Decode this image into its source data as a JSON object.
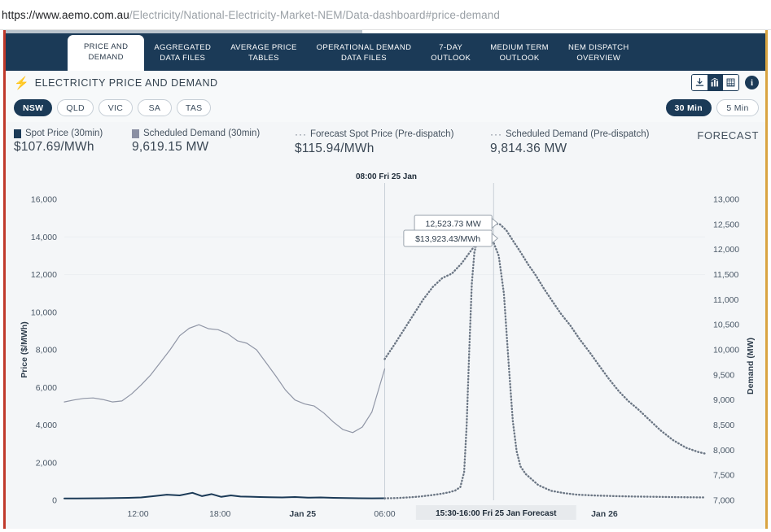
{
  "browser": {
    "url_host": "https://www.aemo.com.au",
    "url_path": "/Electricity/National-Electricity-Market-NEM/Data-dashboard#price-demand"
  },
  "tabs": [
    {
      "label": "PRICE AND\nDEMAND",
      "active": true
    },
    {
      "label": "AGGREGATED\nDATA FILES",
      "active": false
    },
    {
      "label": "AVERAGE PRICE\nTABLES",
      "active": false
    },
    {
      "label": "OPERATIONAL DEMAND\nDATA FILES",
      "active": false
    },
    {
      "label": "7-DAY\nOUTLOOK",
      "active": false
    },
    {
      "label": "MEDIUM TERM\nOUTLOOK",
      "active": false
    },
    {
      "label": "NEM DISPATCH\nOVERVIEW",
      "active": false
    }
  ],
  "header": {
    "title": "ELECTRICITY PRICE AND DEMAND",
    "bolt_icon": "lightning-bolt-icon",
    "icons": [
      {
        "name": "download-icon",
        "glyph": "⤓",
        "active": false
      },
      {
        "name": "chart-icon",
        "glyph": "█",
        "active": true
      },
      {
        "name": "table-icon",
        "glyph": "▦",
        "active": false
      }
    ],
    "info_label": "i"
  },
  "regions": [
    {
      "label": "NSW",
      "selected": true
    },
    {
      "label": "QLD",
      "selected": false
    },
    {
      "label": "VIC",
      "selected": false
    },
    {
      "label": "SA",
      "selected": false
    },
    {
      "label": "TAS",
      "selected": false
    }
  ],
  "intervals": [
    {
      "label": "30 Min",
      "selected": true
    },
    {
      "label": "5 Min",
      "selected": false
    }
  ],
  "legend": [
    {
      "name": "Spot Price (30min)",
      "value": "$107.69/MWh",
      "color": "#1b3a57",
      "style": "solid"
    },
    {
      "name": "Scheduled Demand (30min)",
      "value": "9,619.15 MW",
      "color": "#8a8fa3",
      "style": "solid"
    },
    {
      "name": "Forecast Spot Price (Pre-dispatch)",
      "value": "$115.94/MWh",
      "color": "#6b7684",
      "style": "dotted"
    },
    {
      "name": "Scheduled Demand (Pre-dispatch)",
      "value": "9,814.36 MW",
      "color": "#6b7684",
      "style": "dotted"
    }
  ],
  "forecast_label": "FORECAST",
  "chart_data": {
    "type": "line",
    "title": "ELECTRICITY PRICE AND DEMAND",
    "xlabel": "",
    "ylabel": "Price ($/MWh)",
    "y2label": "Demand (MW)",
    "ylim": [
      0,
      16000
    ],
    "y2lim": [
      7000,
      13000
    ],
    "yticks": [
      0,
      2000,
      4000,
      6000,
      8000,
      10000,
      12000,
      14000,
      16000
    ],
    "yticklabels": [
      "0",
      "2,000",
      "4,000",
      "6,000",
      "8,000",
      "10,000",
      "12,000",
      "14,000",
      "16,000"
    ],
    "y2ticks": [
      7000,
      7500,
      8000,
      8500,
      9000,
      9500,
      10000,
      10500,
      11000,
      11500,
      12000,
      12500,
      13000
    ],
    "y2ticklabels": [
      "7,000",
      "7,500",
      "8,000",
      "8,500",
      "9,000",
      "9,500",
      "10,000",
      "10,500",
      "11,000",
      "11,500",
      "12,000",
      "12,500",
      "13,000"
    ],
    "grid": false,
    "legend_position": "top",
    "xticks": [
      {
        "pos": 0.115,
        "label": "12:00",
        "bold": false
      },
      {
        "pos": 0.243,
        "label": "18:00",
        "bold": false
      },
      {
        "pos": 0.372,
        "label": "Jan 25",
        "bold": true
      },
      {
        "pos": 0.5,
        "label": "06:00",
        "bold": false
      },
      {
        "pos": 0.843,
        "label": "Jan 26",
        "bold": true
      }
    ],
    "now_marker": {
      "pos": 0.5,
      "label": "08:00 Fri 25 Jan"
    },
    "cursor_marker": {
      "pos": 0.67,
      "label": "15:30-16:00 Fri 25 Jan Forecast"
    },
    "tooltips": [
      {
        "text": "12,523.73 MW",
        "pos": 0.67,
        "value": 12523.73,
        "axis": "right"
      },
      {
        "text": "$13,923.43/MWh",
        "pos": 0.67,
        "value": 13923.43,
        "axis": "left"
      }
    ],
    "series": [
      {
        "name": "Spot Price (30min)",
        "axis": "left",
        "style": "solid",
        "color": "#1b3a57",
        "width": 2,
        "x": [
          0.0,
          0.02,
          0.04,
          0.06,
          0.08,
          0.1,
          0.12,
          0.14,
          0.16,
          0.18,
          0.2,
          0.215,
          0.23,
          0.245,
          0.26,
          0.275,
          0.29,
          0.305,
          0.32,
          0.34,
          0.36,
          0.38,
          0.4,
          0.42,
          0.44,
          0.46,
          0.48,
          0.5
        ],
        "y": [
          95,
          100,
          105,
          110,
          115,
          130,
          150,
          220,
          300,
          260,
          400,
          220,
          330,
          180,
          260,
          200,
          190,
          175,
          160,
          150,
          175,
          140,
          150,
          130,
          120,
          110,
          105,
          107.69
        ]
      },
      {
        "name": "Scheduled Demand (30min)",
        "axis": "right",
        "style": "solid",
        "color": "#9096a6",
        "width": 1.2,
        "x": [
          0.0,
          0.015,
          0.03,
          0.045,
          0.06,
          0.075,
          0.09,
          0.105,
          0.12,
          0.135,
          0.15,
          0.165,
          0.18,
          0.195,
          0.21,
          0.225,
          0.24,
          0.255,
          0.27,
          0.285,
          0.3,
          0.315,
          0.33,
          0.345,
          0.36,
          0.375,
          0.39,
          0.405,
          0.42,
          0.435,
          0.45,
          0.465,
          0.48,
          0.5
        ],
        "y": [
          8960,
          9000,
          9030,
          9040,
          9010,
          8960,
          8980,
          9120,
          9300,
          9500,
          9750,
          10000,
          10280,
          10430,
          10500,
          10420,
          10400,
          10320,
          10180,
          10130,
          10000,
          9740,
          9480,
          9200,
          9000,
          8920,
          8880,
          8740,
          8560,
          8410,
          8350,
          8460,
          8760,
          9619.15
        ]
      },
      {
        "name": "Forecast Spot Price (Pre-dispatch)",
        "axis": "left",
        "style": "dotted",
        "color": "#6b7684",
        "width": 2.4,
        "x": [
          0.5,
          0.52,
          0.54,
          0.555,
          0.57,
          0.585,
          0.6,
          0.61,
          0.618,
          0.624,
          0.628,
          0.632,
          0.636,
          0.64,
          0.644,
          0.648,
          0.652,
          0.656,
          0.66,
          0.665,
          0.67,
          0.678,
          0.686,
          0.694,
          0.7,
          0.706,
          0.712,
          0.72,
          0.74,
          0.76,
          0.78,
          0.8,
          0.83,
          0.86,
          0.89,
          0.92,
          0.95,
          0.975,
          1.0
        ],
        "y": [
          105,
          120,
          160,
          200,
          260,
          330,
          420,
          520,
          700,
          1500,
          4000,
          8000,
          11500,
          13200,
          13700,
          13900,
          13923.43,
          13900,
          13850,
          13800,
          13700,
          13000,
          11000,
          7000,
          4200,
          2600,
          1800,
          1400,
          800,
          500,
          380,
          300,
          250,
          220,
          200,
          185,
          170,
          160,
          150
        ]
      },
      {
        "name": "Scheduled Demand (Pre-dispatch)",
        "axis": "right",
        "style": "dotted",
        "color": "#6b7684",
        "width": 2.4,
        "x": [
          0.5,
          0.515,
          0.53,
          0.545,
          0.56,
          0.575,
          0.59,
          0.605,
          0.62,
          0.635,
          0.65,
          0.66,
          0.67,
          0.68,
          0.69,
          0.7,
          0.712,
          0.724,
          0.736,
          0.748,
          0.76,
          0.775,
          0.79,
          0.805,
          0.82,
          0.835,
          0.85,
          0.865,
          0.88,
          0.895,
          0.91,
          0.93,
          0.95,
          0.97,
          0.99,
          1.0
        ],
        "y": [
          9814.36,
          10100,
          10400,
          10700,
          11000,
          11250,
          11430,
          11520,
          11720,
          11980,
          12230,
          12420,
          12523.73,
          12500,
          12380,
          12180,
          11950,
          11700,
          11480,
          11230,
          11000,
          10720,
          10480,
          10200,
          9950,
          9680,
          9420,
          9180,
          8980,
          8820,
          8640,
          8400,
          8200,
          8050,
          7960,
          7930
        ]
      }
    ]
  }
}
